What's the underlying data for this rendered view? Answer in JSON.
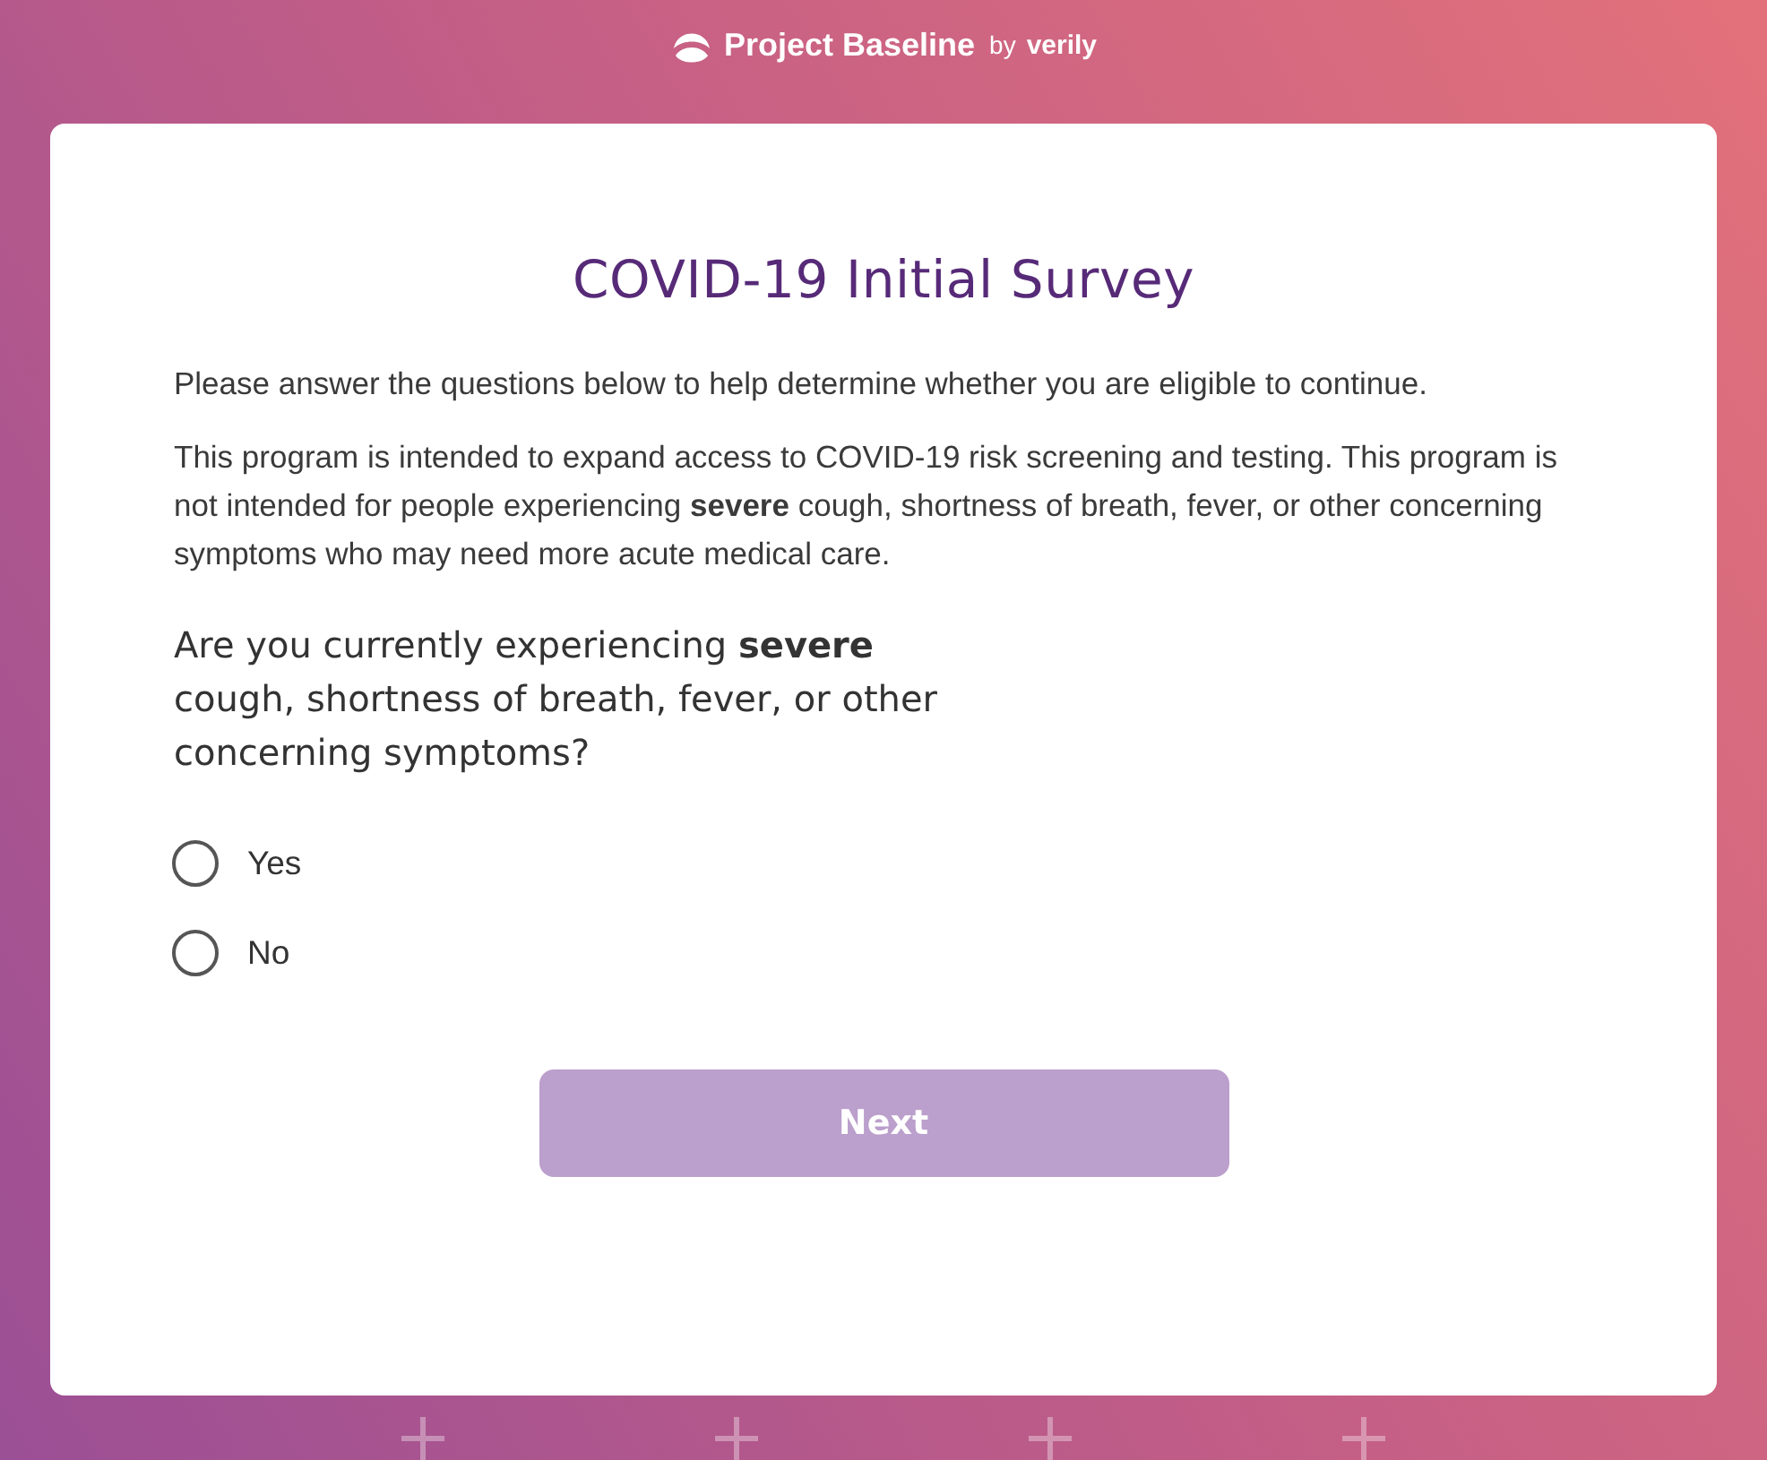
{
  "header": {
    "brand": "Project Baseline",
    "by": "by",
    "partner": "verily"
  },
  "survey": {
    "title": "COVID-19 Initial Survey",
    "intro": "Please answer the questions below to help determine whether you are eligible to continue.",
    "notice": "This program is intended to expand access to COVID-19 risk screening and testing. This program is not intended for people experiencing **severe** cough, shortness of breath, fever, or other concerning symptoms who may need more acute medical care.",
    "question": "Are you currently experiencing **severe** cough, shortness of breath, fever, or other concerning symptoms?",
    "options": [
      {
        "label": "Yes",
        "selected": false
      },
      {
        "label": "No",
        "selected": false
      }
    ],
    "next_button": {
      "label": "Next",
      "disabled": true
    }
  }
}
